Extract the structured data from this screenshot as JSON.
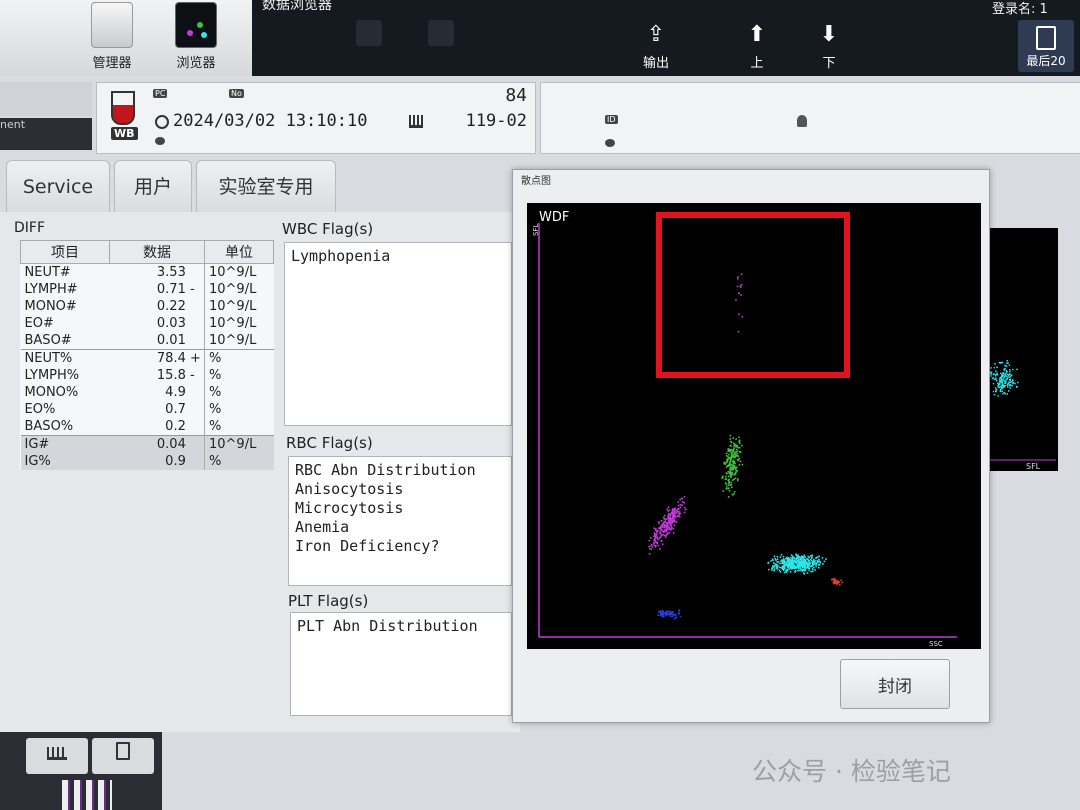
{
  "toolbar": {
    "title": "数据浏览器",
    "manager_label": "管理器",
    "browser_label": "浏览器",
    "login_label": "登录名: 1",
    "export_label": "输出",
    "up_label": "上",
    "down_label": "下",
    "last20_label": "最后20"
  },
  "sample": {
    "count": "84",
    "datetime": "2024/03/02 13:10:10",
    "rack": "119-02",
    "tube_badge": "WB",
    "pc_badge": "PC",
    "no_badge": "No",
    "id_badge": "ID",
    "left_stub_text": "nent"
  },
  "tabs": [
    {
      "label": "Service"
    },
    {
      "label": "用户"
    },
    {
      "label": "实验室专用"
    }
  ],
  "diff": {
    "title": "DIFF",
    "headers": [
      "项目",
      "数据",
      "单位"
    ],
    "rows": [
      {
        "item": "NEUT#",
        "value": "3.53",
        "flag": "",
        "unit": "10^9/L"
      },
      {
        "item": "LYMPH#",
        "value": "0.71",
        "flag": "-",
        "unit": "10^9/L"
      },
      {
        "item": "MONO#",
        "value": "0.22",
        "flag": "",
        "unit": "10^9/L"
      },
      {
        "item": "EO#",
        "value": "0.03",
        "flag": "",
        "unit": "10^9/L"
      },
      {
        "item": "BASO#",
        "value": "0.01",
        "flag": "",
        "unit": "10^9/L"
      },
      {
        "item": "NEUT%",
        "value": "78.4",
        "flag": "+",
        "unit": "%"
      },
      {
        "item": "LYMPH%",
        "value": "15.8",
        "flag": "-",
        "unit": "%"
      },
      {
        "item": "MONO%",
        "value": "4.9",
        "flag": "",
        "unit": "%"
      },
      {
        "item": "EO%",
        "value": "0.7",
        "flag": "",
        "unit": "%"
      },
      {
        "item": "BASO%",
        "value": "0.2",
        "flag": "",
        "unit": "%"
      },
      {
        "item": "IG#",
        "value": "0.04",
        "flag": "",
        "unit": "10^9/L"
      },
      {
        "item": "IG%",
        "value": "0.9",
        "flag": "",
        "unit": "%"
      }
    ]
  },
  "flags": {
    "wbc_label": "WBC Flag(s)",
    "wbc": [
      "Lymphopenia"
    ],
    "rbc_label": "RBC Flag(s)",
    "rbc": [
      "RBC Abn Distribution",
      "Anisocytosis",
      "Microcytosis",
      "Anemia",
      "Iron Deficiency?"
    ],
    "plt_label": "PLT Flag(s)",
    "plt": [
      "PLT Abn Distribution"
    ]
  },
  "scatter_dialog": {
    "title": "散点图",
    "plot_name": "WDF",
    "x_axis": "SSC",
    "y_axis": "SFL",
    "close_label": "封闭",
    "highlight_color": "#e0141b",
    "clusters": [
      {
        "name": "cyan",
        "color": "#2fe6e8"
      },
      {
        "name": "magenta",
        "color": "#c23bd6"
      },
      {
        "name": "green",
        "color": "#3cc43c"
      },
      {
        "name": "blue",
        "color": "#2a3bd8"
      },
      {
        "name": "red",
        "color": "#e04030"
      }
    ]
  },
  "background_plot": {
    "axis_label": "SFL"
  },
  "watermark": "公众号 · 检验笔记"
}
